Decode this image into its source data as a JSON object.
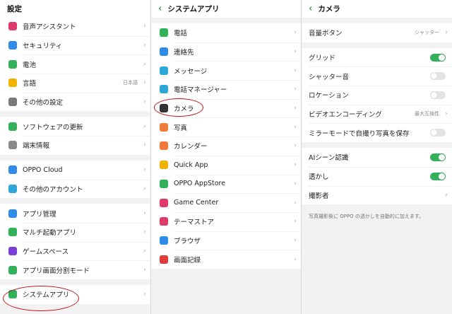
{
  "settings": {
    "title": "設定",
    "groups": [
      [
        {
          "label": "音声アシスタント",
          "icon": "mic-icon",
          "color": "#e03a6a"
        },
        {
          "label": "セキュリティ",
          "icon": "shield-icon",
          "color": "#2f8be6"
        },
        {
          "label": "電池",
          "icon": "battery-icon",
          "color": "#33b15a"
        },
        {
          "label": "言語",
          "icon": "language-icon",
          "color": "#f2b200",
          "value": "日本語"
        },
        {
          "label": "その他の設定",
          "icon": "gear-icon",
          "color": "#7a7a7a"
        }
      ],
      [
        {
          "label": "ソフトウェアの更新",
          "icon": "update-icon",
          "color": "#33b15a"
        },
        {
          "label": "端末情報",
          "icon": "info-icon",
          "color": "#8a8a8a"
        }
      ],
      [
        {
          "label": "OPPO Cloud",
          "icon": "cloud-icon",
          "color": "#2f8be6"
        },
        {
          "label": "その他のアカウント",
          "icon": "account-icon",
          "color": "#2fa6d8"
        }
      ],
      [
        {
          "label": "アプリ管理",
          "icon": "apps-grid-icon",
          "color": "#2f8be6"
        },
        {
          "label": "マルチ起動アプリ",
          "icon": "multi-app-icon",
          "color": "#33b15a"
        },
        {
          "label": "ゲームスペース",
          "icon": "game-space-icon",
          "color": "#7b3fd6"
        },
        {
          "label": "アプリ画面分割モード",
          "icon": "split-screen-icon",
          "color": "#33b15a"
        }
      ],
      [
        {
          "label": "システムアプリ",
          "icon": "system-apps-icon",
          "color": "#33b15a"
        }
      ]
    ]
  },
  "system_apps": {
    "title": "システムアプリ",
    "items": [
      {
        "label": "電話",
        "icon": "phone-icon",
        "color": "#33b15a"
      },
      {
        "label": "連絡先",
        "icon": "contacts-icon",
        "color": "#2f8be6"
      },
      {
        "label": "メッセージ",
        "icon": "message-icon",
        "color": "#2fa6d8"
      },
      {
        "label": "電話マネージャー",
        "icon": "phone-manager-icon",
        "color": "#2fa6d8"
      },
      {
        "label": "カメラ",
        "icon": "camera-icon",
        "color": "#333333"
      },
      {
        "label": "写真",
        "icon": "photos-icon",
        "color": "#f07a3a"
      },
      {
        "label": "カレンダー",
        "icon": "calendar-icon",
        "color": "#f07a3a"
      },
      {
        "label": "Quick App",
        "icon": "quick-app-icon",
        "color": "#f2b200"
      },
      {
        "label": "OPPO AppStore",
        "icon": "appstore-icon",
        "color": "#33b15a"
      },
      {
        "label": "Game Center",
        "icon": "game-center-icon",
        "color": "#e03a6a"
      },
      {
        "label": "テーマストア",
        "icon": "theme-store-icon",
        "color": "#e03a6a"
      },
      {
        "label": "ブラウザ",
        "icon": "browser-icon",
        "color": "#2f8be6"
      },
      {
        "label": "画面記録",
        "icon": "screen-record-icon",
        "color": "#e03a3a"
      }
    ]
  },
  "camera": {
    "title": "カメラ",
    "groups": [
      [
        {
          "label": "音量ボタン",
          "value": "シャッター"
        }
      ],
      [
        {
          "label": "グリッド",
          "toggle": true
        },
        {
          "label": "シャッター音",
          "toggle": false
        },
        {
          "label": "ロケーション",
          "toggle": false
        },
        {
          "label": "ビデオエンコーディング",
          "value": "最大互換性"
        },
        {
          "label": "ミラーモードで自撮り写真を保存",
          "toggle": false
        }
      ],
      [
        {
          "label": "AIシーン認識",
          "toggle": true
        },
        {
          "label": "透かし",
          "toggle": true
        },
        {
          "label": "撮影者",
          "chevron": true
        }
      ]
    ],
    "note": "写真撮影後に OPPO の透かしを自動的に加えます。"
  }
}
